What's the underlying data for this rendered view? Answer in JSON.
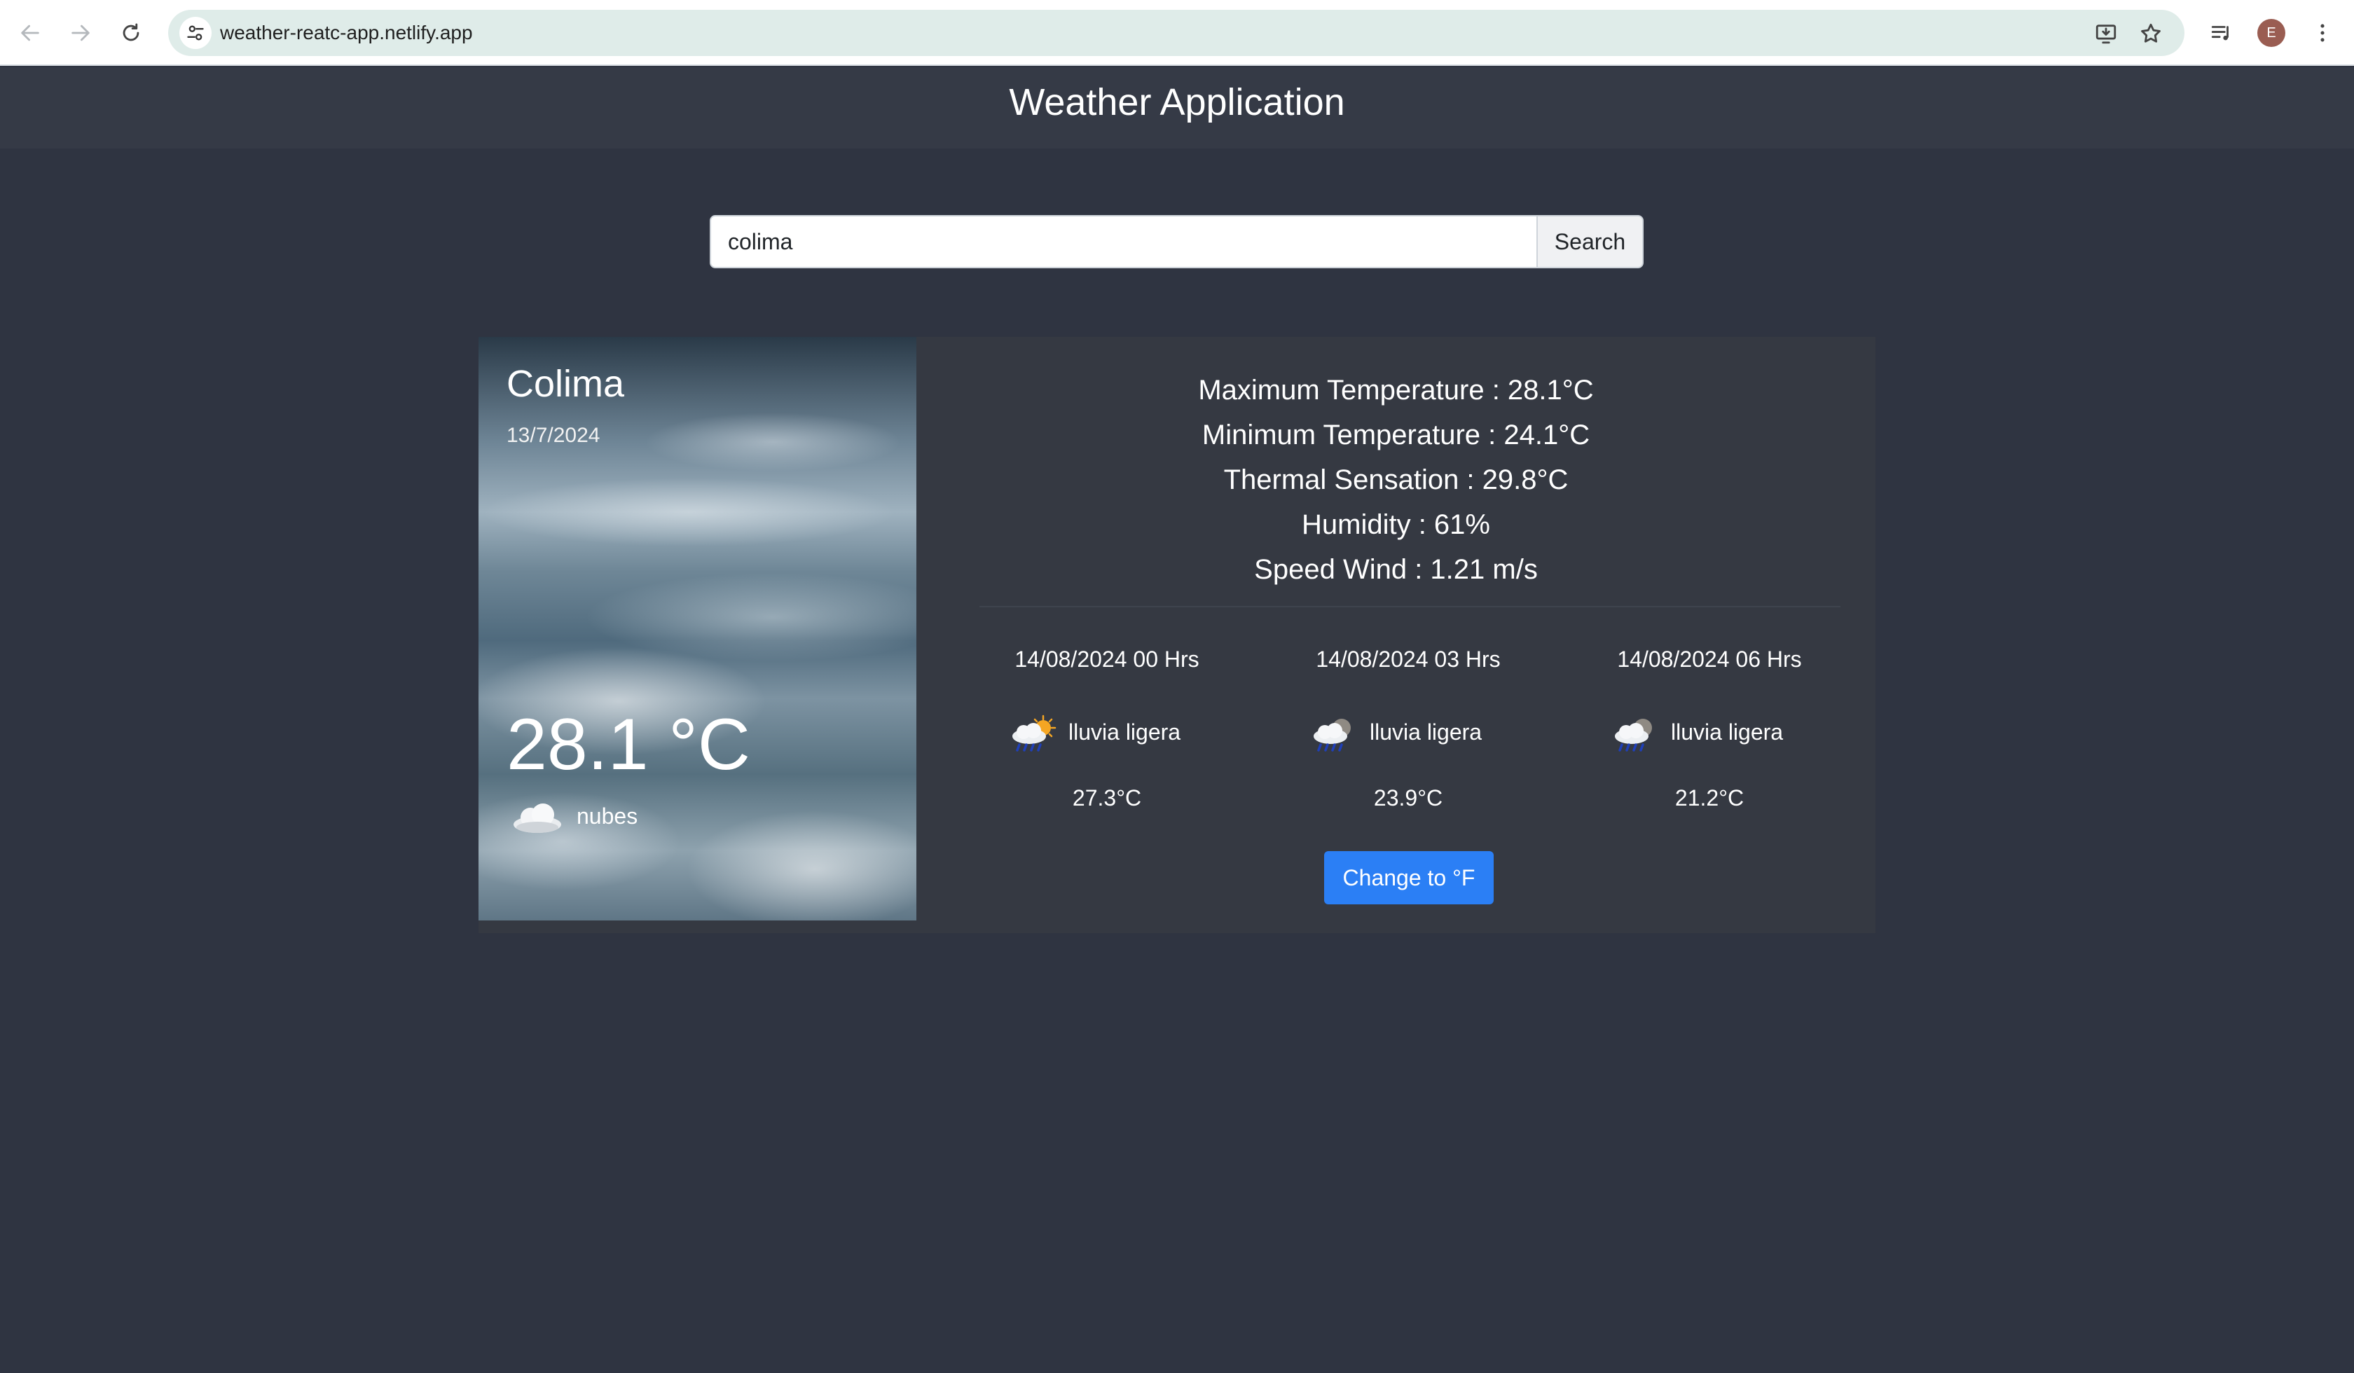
{
  "browser": {
    "url": "weather-reatc-app.netlify.app",
    "profile_initial": "E",
    "icons": {
      "back": "arrow-left-icon",
      "forward": "arrow-right-icon",
      "reload": "reload-icon",
      "site_info": "tune-icon",
      "install": "install-app-icon",
      "bookmark": "star-icon",
      "media": "playlist-icon",
      "menu": "kebab-menu-icon"
    }
  },
  "header": {
    "title": "Weather Application"
  },
  "search": {
    "value": "colima",
    "button_label": "Search"
  },
  "current": {
    "city": "Colima",
    "date": "13/7/2024",
    "temperature": "28.1 °C",
    "icon": "cloud-icon",
    "description": "nubes"
  },
  "details": {
    "max_temp": "Maximum Temperature : 28.1°C",
    "min_temp": "Minimum Temperature : 24.1°C",
    "thermal": "Thermal Sensation : 29.8°C",
    "humidity": "Humidity : 61%",
    "wind": "Speed Wind : 1.21 m/s"
  },
  "forecast": [
    {
      "time": "14/08/2024 00 Hrs",
      "icon": "rain-sun-icon",
      "description": "lluvia ligera",
      "temperature": "27.3°C"
    },
    {
      "time": "14/08/2024 03 Hrs",
      "icon": "rain-cloud-icon",
      "description": "lluvia ligera",
      "temperature": "23.9°C"
    },
    {
      "time": "14/08/2024 06 Hrs",
      "icon": "rain-cloud-icon",
      "description": "lluvia ligera",
      "temperature": "21.2°C"
    }
  ],
  "unit_toggle": {
    "label": "Change to °F"
  },
  "colors": {
    "page_background": "#2f3441",
    "header_background": "#353a46",
    "card_background": "#353942",
    "accent_button": "#2b7ff5"
  }
}
